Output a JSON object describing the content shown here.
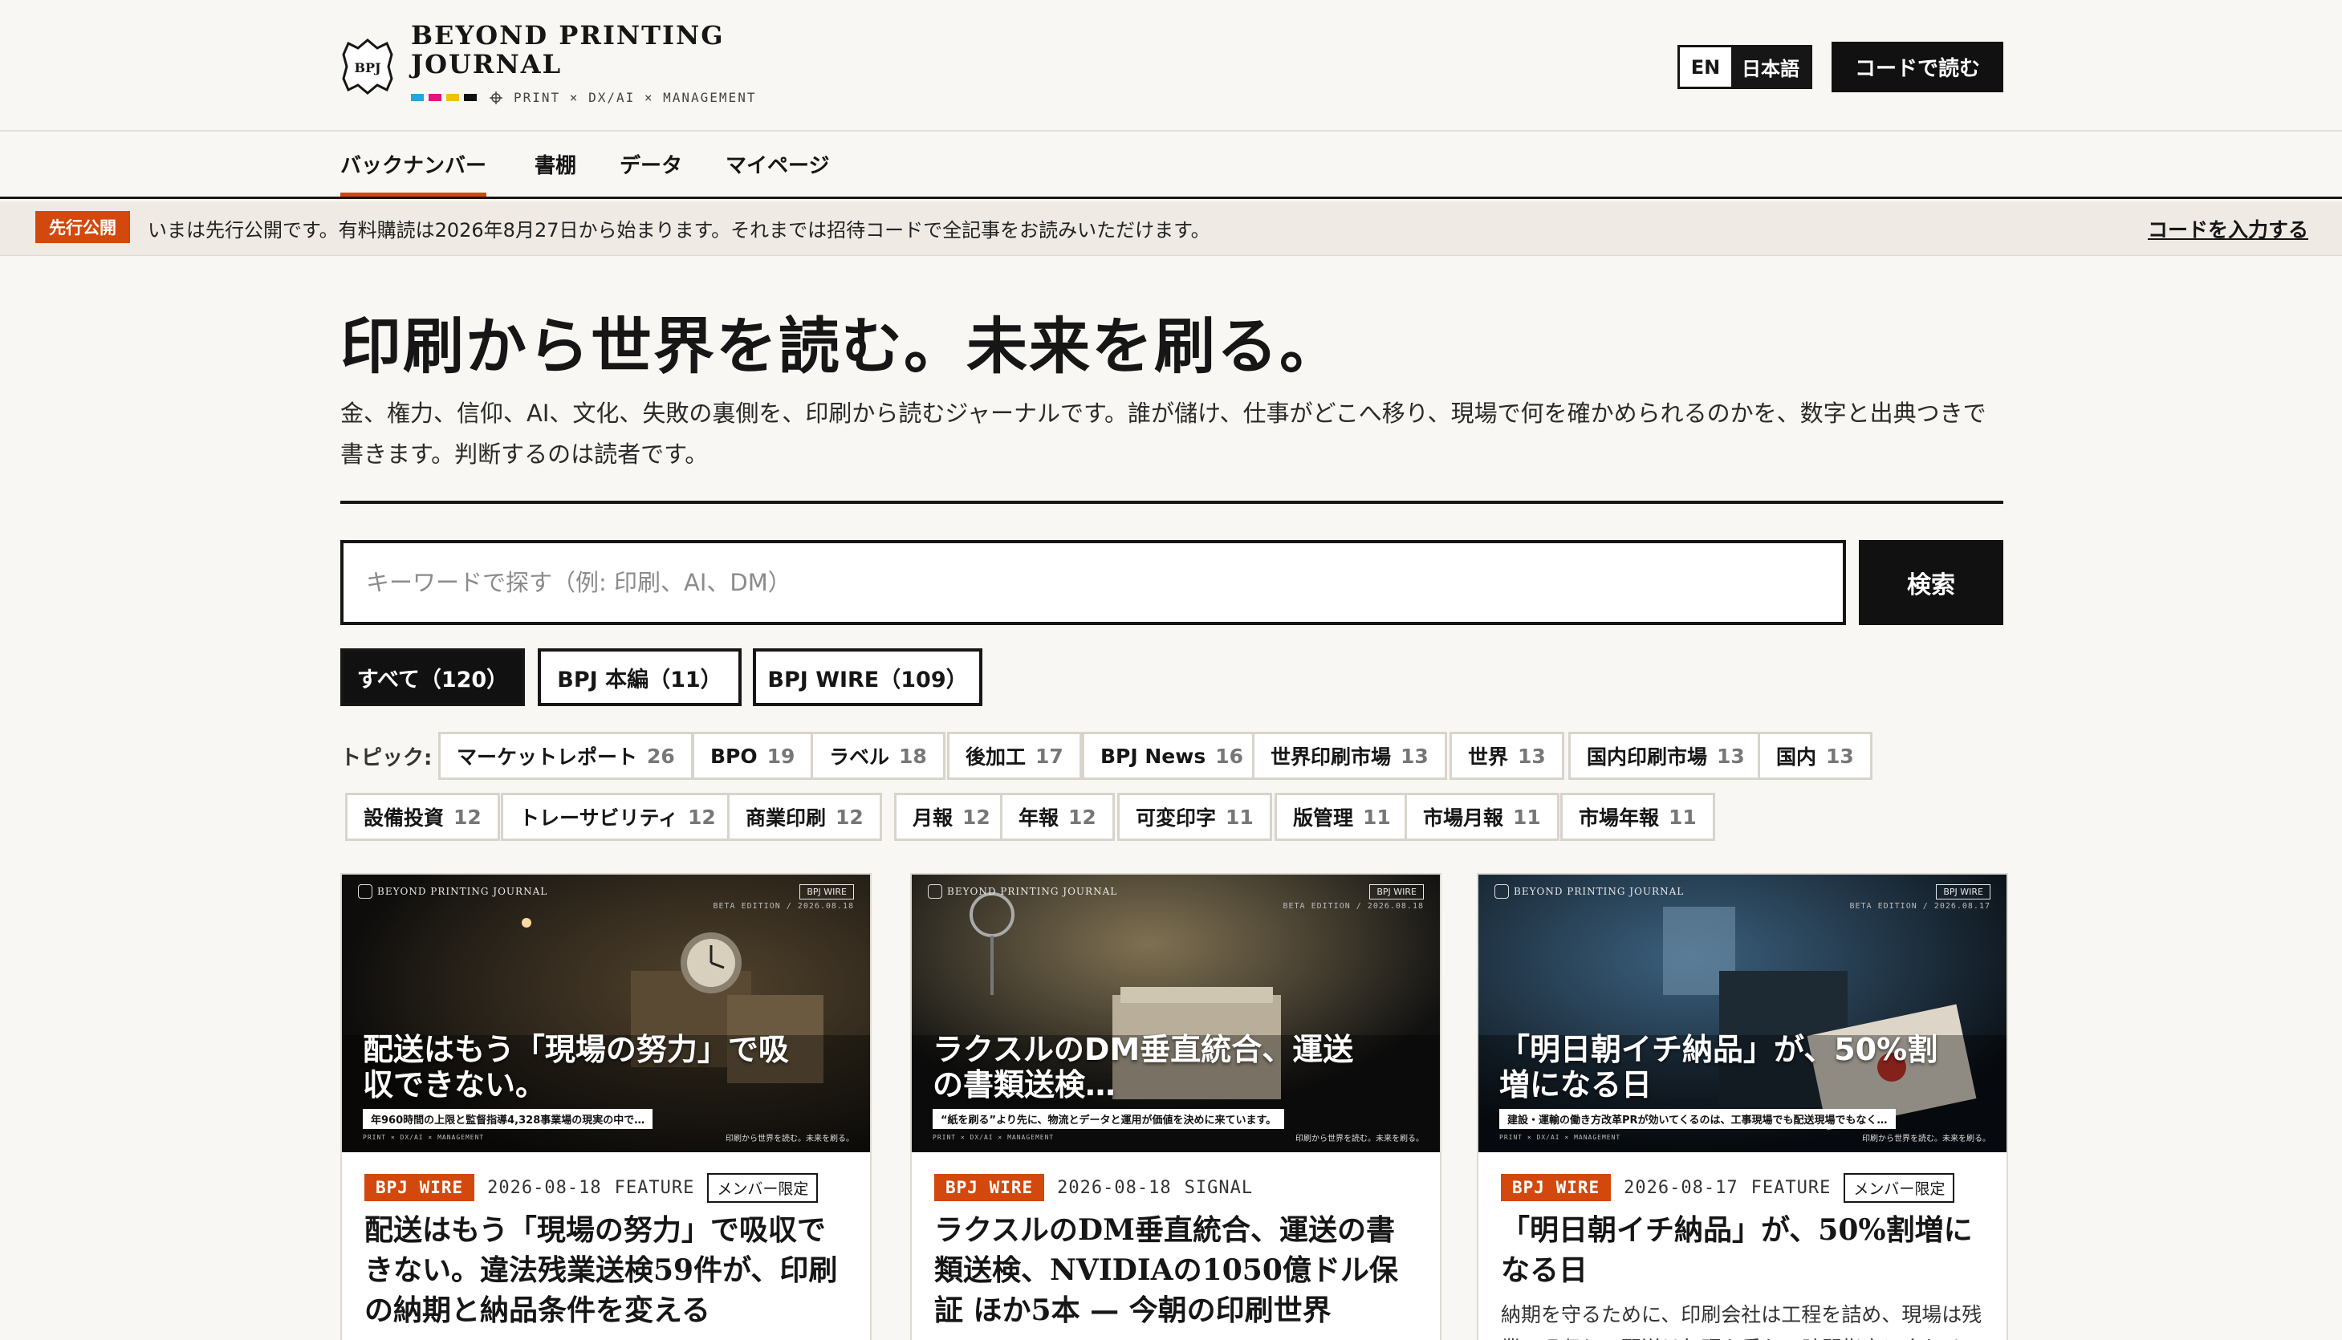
{
  "brand": {
    "name_line1": "BEYOND PRINTING",
    "name_line2": "JOURNAL",
    "logo_mark": "BPJ",
    "tagline": "PRINT × DX/AI × MANAGEMENT",
    "swatch_colors": [
      "#1ea7e1",
      "#e1177a",
      "#f2c200",
      "#111111"
    ]
  },
  "header": {
    "lang_en": "EN",
    "lang_ja": "日本語",
    "code_button": "コードで読む"
  },
  "nav": {
    "items": [
      {
        "label": "バックナンバー",
        "active": true
      },
      {
        "label": "書棚",
        "active": false
      },
      {
        "label": "データ",
        "active": false
      },
      {
        "label": "マイページ",
        "active": false
      }
    ]
  },
  "notice": {
    "badge": "先行公開",
    "text": "いまは先行公開です。有料購読は2026年8月27日から始まります。それまでは招待コードで全記事をお読みいただけます。",
    "link": "コードを入力する"
  },
  "hero": {
    "title": "印刷から世界を読む。未来を刷る。",
    "description": "金、権力、信仰、AI、文化、失敗の裏側を、印刷から読むジャーナルです。誰が儲け、仕事がどこへ移り、現場で何を確かめられるのかを、数字と出典つきで書きます。判断するのは読者です。"
  },
  "search": {
    "placeholder": "キーワードで探す（例: 印刷、AI、DM）",
    "value": "",
    "button": "検索"
  },
  "filters": [
    {
      "label": "すべて（120）",
      "active": true
    },
    {
      "label": "BPJ 本編（11）",
      "active": false
    },
    {
      "label": "BPJ WIRE（109）",
      "active": false
    }
  ],
  "topics": {
    "label": "トピック:",
    "items": [
      {
        "name": "マーケットレポート",
        "count": "26"
      },
      {
        "name": "BPO",
        "count": "19"
      },
      {
        "name": "ラベル",
        "count": "18"
      },
      {
        "name": "後加工",
        "count": "17"
      },
      {
        "name": "BPJ News",
        "count": "16"
      },
      {
        "name": "世界印刷市場",
        "count": "13"
      },
      {
        "name": "世界",
        "count": "13"
      },
      {
        "name": "国内印刷市場",
        "count": "13"
      },
      {
        "name": "国内",
        "count": "13"
      },
      {
        "name": "設備投資",
        "count": "12"
      },
      {
        "name": "トレーサビリティ",
        "count": "12"
      },
      {
        "name": "商業印刷",
        "count": "12"
      },
      {
        "name": "月報",
        "count": "12"
      },
      {
        "name": "年報",
        "count": "12"
      },
      {
        "name": "可変印字",
        "count": "11"
      },
      {
        "name": "版管理",
        "count": "11"
      },
      {
        "name": "市場月報",
        "count": "11"
      },
      {
        "name": "市場年報",
        "count": "11"
      }
    ]
  },
  "cards": [
    {
      "thumb_brand": "BEYOND PRINTING JOURNAL",
      "thumb_tag": "BPJ WIRE",
      "thumb_edition": "BETA EDITION / 2026.08.18",
      "thumb_headline": "配送はもう「現場の努力」で吸収できない。",
      "thumb_sub": "年960時間の上限と監督指導4,328事業場の現実の中で…",
      "thumb_foot": "PRINT × DX/AI × MANAGEMENT",
      "thumb_foot_right": "印刷から世界を読む。未来を刷る。",
      "source": "BPJ WIRE",
      "date": "2026-08-18",
      "kind": "FEATURE",
      "member": "メンバー限定",
      "title": "配送はもう「現場の努力」で吸収できない。違法残業送検59件が、印刷の納期と納品条件を変える",
      "excerpt": ""
    },
    {
      "thumb_brand": "BEYOND PRINTING JOURNAL",
      "thumb_tag": "BPJ WIRE",
      "thumb_edition": "BETA EDITION / 2026.08.18",
      "thumb_headline": "ラクスルのDM垂直統合、運送の書類送検…",
      "thumb_sub": "“紙を刷る”より先に、物流とデータと運用が価値を決めに来ています。",
      "thumb_foot": "PRINT × DX/AI × MANAGEMENT",
      "thumb_foot_right": "印刷から世界を読む。未来を刷る。",
      "source": "BPJ WIRE",
      "date": "2026-08-18",
      "kind": "SIGNAL",
      "member": "",
      "title": "ラクスルのDM垂直統合、運送の書類送検、NVIDIAの1050億ドル保証 ほか5本 — 今朝の印刷世界",
      "excerpt": ""
    },
    {
      "thumb_brand": "BEYOND PRINTING JOURNAL",
      "thumb_tag": "BPJ WIRE",
      "thumb_edition": "BETA EDITION / 2026.08.17",
      "thumb_headline": "「明日朝イチ納品」が、50%割増になる日",
      "thumb_sub": "建設・運輸の働き方改革PRが効いてくるのは、工事現場でも配送現場でもなく…",
      "thumb_foot": "PRINT × DX/AI × MANAGEMENT",
      "thumb_foot_right": "印刷から世界を読む。未来を刷る。",
      "source": "BPJ WIRE",
      "date": "2026-08-17",
      "kind": "FEATURE",
      "member": "メンバー限定",
      "title": "「明日朝イチ納品」が、50%割増になる日",
      "excerpt": "納期を守るために、印刷会社は工程を詰め、現場は残業で吸収し、配送は無理を重ねて時間指定に合わせてきた。"
    }
  ],
  "colors": {
    "accent": "#d3480c",
    "ink": "#161616",
    "background": "#f9f7f3"
  }
}
